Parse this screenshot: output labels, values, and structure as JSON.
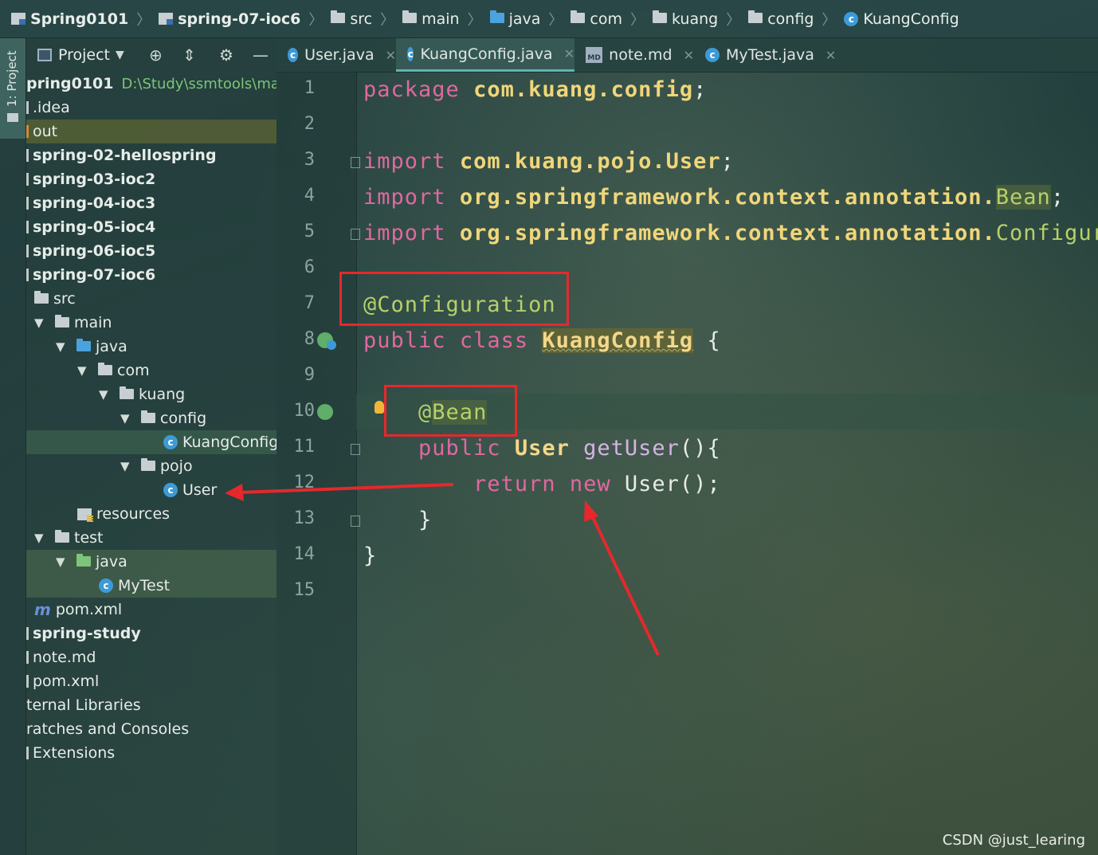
{
  "breadcrumb": {
    "items": [
      "Spring0101",
      "spring-07-ioc6",
      "src",
      "main",
      "java",
      "com",
      "kuang",
      "config",
      "KuangConfig"
    ]
  },
  "stripe": {
    "label": "1: Project"
  },
  "project_panel": {
    "title": "Project",
    "tree": {
      "root": "pring0101",
      "root_path": "D:\\Study\\ssmtools\\mavar",
      "idea": ".idea",
      "out": "out",
      "m2": "spring-02-hellospring",
      "m3": "spring-03-ioc2",
      "m4": "spring-04-ioc3",
      "m5": "spring-05-ioc4",
      "m6": "spring-06-ioc5",
      "m7": "spring-07-ioc6",
      "src": "src",
      "main": "main",
      "java": "java",
      "com": "com",
      "kuang": "kuang",
      "config": "config",
      "kuangconfig": "KuangConfig",
      "pojo": "pojo",
      "user": "User",
      "resources": "resources",
      "test": "test",
      "test_java": "java",
      "mytest": "MyTest",
      "pom_inner": "pom.xml",
      "study": "spring-study",
      "note": "note.md",
      "pom_outer": "pom.xml",
      "ext_libs": "ternal Libraries",
      "scratches": "ratches and Consoles",
      "extensions": "Extensions"
    }
  },
  "tabs": [
    {
      "label": "User.java",
      "icon": "class-icon"
    },
    {
      "label": "KuangConfig.java",
      "icon": "class-icon",
      "active": true
    },
    {
      "label": "note.md",
      "icon": "markdown-icon"
    },
    {
      "label": "MyTest.java",
      "icon": "test-class-icon"
    }
  ],
  "editor": {
    "line_numbers": [
      "1",
      "2",
      "3",
      "4",
      "5",
      "6",
      "7",
      "8",
      "9",
      "10",
      "11",
      "12",
      "13",
      "14",
      "15"
    ],
    "tokens": {
      "package_kw": "package",
      "package_name": "com.kuang.config",
      "semi": ";",
      "import_kw": "import",
      "import1": "com.kuang.pojo.User",
      "import2_pre": "org.springframework.context.annotation.",
      "import2_cls": "Bean",
      "import3_pre": "org.springframework.context.annotation.",
      "import3_cls": "Configura",
      "annotation_config": "@Configuration",
      "public_kw": "public",
      "class_kw": "class",
      "class_name": "KuangConfig",
      "brace_open": "{",
      "annotation_bean_at": "@",
      "annotation_bean": "Bean",
      "ret_type": "User",
      "method": "getUser",
      "method_tail": "(){",
      "return_kw": "return",
      "new_kw": "new",
      "new_expr": "User();",
      "brace_close": "}"
    }
  },
  "watermark": "CSDN @just_learing",
  "colors": {
    "keyword": "#e0689f",
    "annotation": "#b7d06a",
    "highlight_box": "#e6282c"
  }
}
